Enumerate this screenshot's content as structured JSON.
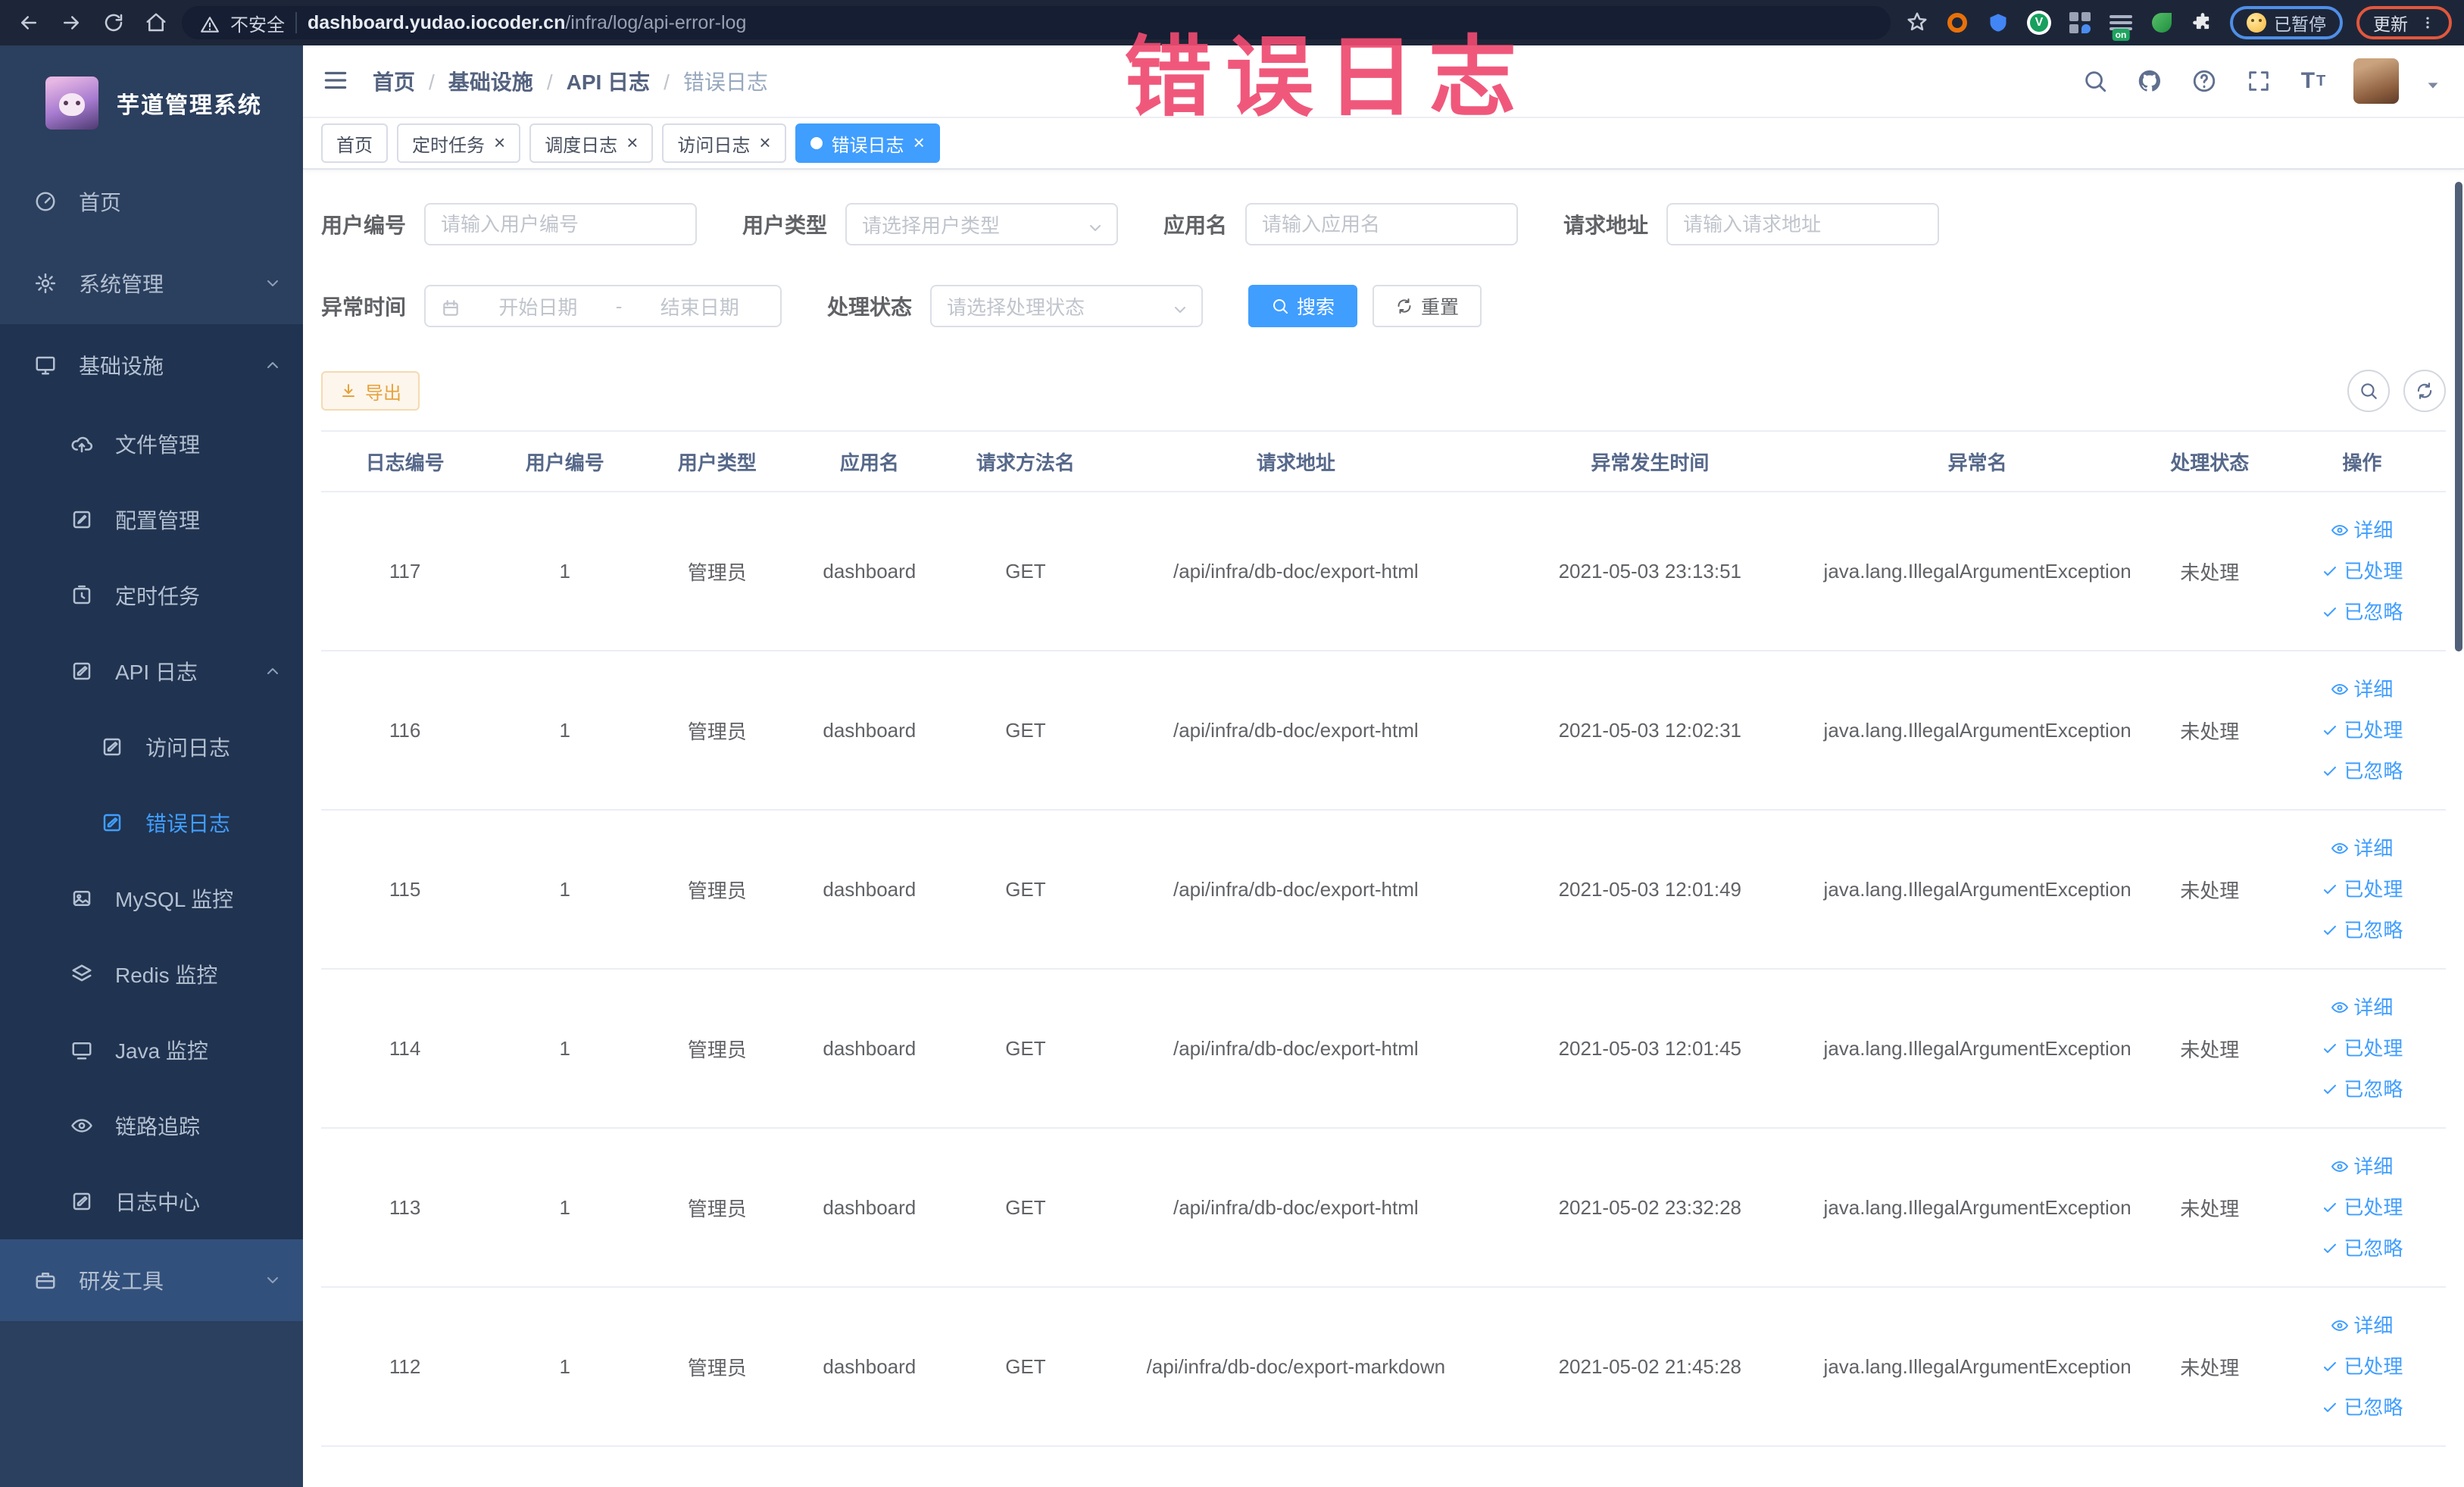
{
  "browser": {
    "security_label": "不安全",
    "url_host": "dashboard.yudao.iocoder.cn",
    "url_path": "/infra/log/api-error-log",
    "ext_badge": "on",
    "paused_badge": "已暂停",
    "update_label": "更新"
  },
  "annotation": {
    "title": "错误日志"
  },
  "sidebar": {
    "logo_title": "芋道管理系统",
    "items": [
      {
        "label": "首页",
        "icon": "dashboard-icon",
        "level": 0
      },
      {
        "label": "系统管理",
        "icon": "gear-icon",
        "level": 0,
        "chevron": "chevron-down-icon"
      },
      {
        "label": "基础设施",
        "icon": "monitor-icon",
        "level": 0,
        "chevron": "chevron-up-icon",
        "open": true
      },
      {
        "label": "文件管理",
        "icon": "cloud-upload-icon",
        "level": 1,
        "sub": true
      },
      {
        "label": "配置管理",
        "icon": "edit-icon",
        "level": 1,
        "sub": true
      },
      {
        "label": "定时任务",
        "icon": "timer-icon",
        "level": 1,
        "sub": true
      },
      {
        "label": "API 日志",
        "icon": "log-icon",
        "level": 1,
        "sub": true,
        "chevron": "chevron-up-icon"
      },
      {
        "label": "访问日志",
        "icon": "log-icon",
        "level": 2,
        "sub": true
      },
      {
        "label": "错误日志",
        "icon": "log-icon",
        "level": 2,
        "sub": true,
        "active": true
      },
      {
        "label": "MySQL 监控",
        "icon": "image-icon",
        "level": 1,
        "sub": true
      },
      {
        "label": "Redis 监控",
        "icon": "layers-icon",
        "level": 1,
        "sub": true
      },
      {
        "label": "Java 监控",
        "icon": "screen-icon",
        "level": 1,
        "sub": true
      },
      {
        "label": "链路追踪",
        "icon": "eye-icon",
        "level": 1,
        "sub": true
      },
      {
        "label": "日志中心",
        "icon": "log-icon",
        "level": 1,
        "sub": true
      },
      {
        "label": "研发工具",
        "icon": "briefcase-icon",
        "level": 0,
        "highlight": true,
        "chevron": "chevron-down-icon"
      }
    ]
  },
  "breadcrumb": {
    "items": [
      "首页",
      "基础设施",
      "API 日志"
    ],
    "current": "错误日志"
  },
  "tabs": [
    {
      "label": "首页"
    },
    {
      "label": "定时任务",
      "closable": true
    },
    {
      "label": "调度日志",
      "closable": true
    },
    {
      "label": "访问日志",
      "closable": true
    },
    {
      "label": "错误日志",
      "closable": true,
      "active": true
    }
  ],
  "filters": {
    "user_id": {
      "label": "用户编号",
      "placeholder": "请输入用户编号"
    },
    "user_type": {
      "label": "用户类型",
      "placeholder": "请选择用户类型"
    },
    "app_name": {
      "label": "应用名",
      "placeholder": "请输入应用名"
    },
    "request_url": {
      "label": "请求地址",
      "placeholder": "请输入请求地址"
    },
    "exception_time": {
      "label": "异常时间",
      "start_placeholder": "开始日期",
      "separator": "-",
      "end_placeholder": "结束日期"
    },
    "process_status": {
      "label": "处理状态",
      "placeholder": "请选择处理状态"
    },
    "search_label": "搜索",
    "reset_label": "重置"
  },
  "toolbar": {
    "export_label": "导出"
  },
  "table": {
    "columns": [
      "日志编号",
      "用户编号",
      "用户类型",
      "应用名",
      "请求方法名",
      "请求地址",
      "异常发生时间",
      "异常名",
      "处理状态",
      "操作"
    ],
    "action_labels": {
      "detail": "详细",
      "processed": "已处理",
      "ignored": "已忽略"
    },
    "rows": [
      {
        "id": "117",
        "user_id": "1",
        "user_type": "管理员",
        "app": "dashboard",
        "method": "GET",
        "url": "/api/infra/db-doc/export-html",
        "time": "2021-05-03 23:13:51",
        "exception": "java.lang.IllegalArgumentException",
        "status": "未处理"
      },
      {
        "id": "116",
        "user_id": "1",
        "user_type": "管理员",
        "app": "dashboard",
        "method": "GET",
        "url": "/api/infra/db-doc/export-html",
        "time": "2021-05-03 12:02:31",
        "exception": "java.lang.IllegalArgumentException",
        "status": "未处理"
      },
      {
        "id": "115",
        "user_id": "1",
        "user_type": "管理员",
        "app": "dashboard",
        "method": "GET",
        "url": "/api/infra/db-doc/export-html",
        "time": "2021-05-03 12:01:49",
        "exception": "java.lang.IllegalArgumentException",
        "status": "未处理"
      },
      {
        "id": "114",
        "user_id": "1",
        "user_type": "管理员",
        "app": "dashboard",
        "method": "GET",
        "url": "/api/infra/db-doc/export-html",
        "time": "2021-05-03 12:01:45",
        "exception": "java.lang.IllegalArgumentException",
        "status": "未处理"
      },
      {
        "id": "113",
        "user_id": "1",
        "user_type": "管理员",
        "app": "dashboard",
        "method": "GET",
        "url": "/api/infra/db-doc/export-html",
        "time": "2021-05-02 23:32:28",
        "exception": "java.lang.IllegalArgumentException",
        "status": "未处理"
      },
      {
        "id": "112",
        "user_id": "1",
        "user_type": "管理员",
        "app": "dashboard",
        "method": "GET",
        "url": "/api/infra/db-doc/export-markdown",
        "time": "2021-05-02 21:45:28",
        "exception": "java.lang.IllegalArgumentException",
        "status": "未处理"
      }
    ]
  }
}
